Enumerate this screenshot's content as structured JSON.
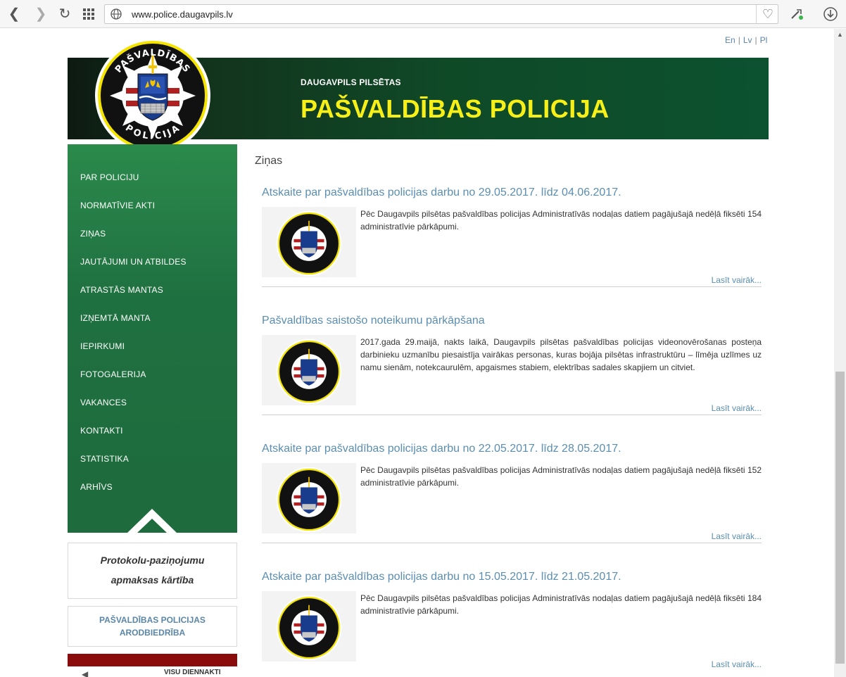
{
  "browser": {
    "url": "www.police.daugavpils.lv"
  },
  "languages": [
    "En",
    "Lv",
    "Pl"
  ],
  "banner": {
    "subtitle": "DAUGAVPILS PILSĒTAS",
    "title": "PAŠVALDĪBAS POLICIJA",
    "logo_text_top": "PAŠVALDĪBAS",
    "logo_text_bottom": "POLICIJA"
  },
  "menu": [
    "PAR POLICIJU",
    "NORMATĪVIE AKTI",
    "ZIŅAS",
    "JAUTĀJUMI UN ATBILDES",
    "ATRASTĀS MANTAS",
    "IZŅEMTĀ MANTA",
    "IEPIRKUMI",
    "FOTOGALERIJA",
    "VAKANCES",
    "KONTAKTI",
    "STATISTIKA",
    "ARHĪVS"
  ],
  "sidebar": {
    "box1_line1": "Protokolu-paziņojumu",
    "box1_line2": "apmaksas kārtība",
    "box2_line1": "PAŠVALDĪBAS POLICIJAS",
    "box2_line2": "ARODBIEDRĪBA",
    "box4_text": "VISU DIENNAKTI"
  },
  "section_title": "Ziņas",
  "news": [
    {
      "title": "Atskaite par pašvaldības policijas darbu no 29.05.2017. līdz 04.06.2017.",
      "text": "Pēc Daugavpils pilsētas pašvaldības policijas Administratīvās nodaļas datiem pagājušajā nedēļā fiksēti 154 administratīvie pārkāpumi.",
      "more": "Lasīt vairāk..."
    },
    {
      "title": "Pašvaldības saistošo noteikumu pārkāpšana",
      "text": "2017.gada 29.maijā, nakts laikā, Daugavpils pilsētas pašvaldības policijas videonovērošanas posteņa darbinieku uzmanību piesaistīja vairākas personas, kuras bojāja pilsētas infrastruktūru – līmēja uzlīmes uz namu sienām, notekcaurulēm, apgaismes stabiem, elektrības sadales skapjiem un citviet.",
      "more": "Lasīt vairāk..."
    },
    {
      "title": "Atskaite par pašvaldības policijas darbu no 22.05.2017. līdz 28.05.2017.",
      "text": "Pēc Daugavpils pilsētas pašvaldības policijas Administratīvās nodaļas datiem pagājušajā nedēļā fiksēti 152 administratīvie pārkāpumi.",
      "more": "Lasīt vairāk..."
    },
    {
      "title": "Atskaite par pašvaldības policijas darbu no 15.05.2017. līdz 21.05.2017.",
      "text": "Pēc Daugavpils pilsētas pašvaldības policijas Administratīvās nodaļas datiem pagājušajā nedēļā fiksēti 184 administratīvie pārkāpumi.",
      "more": "Lasīt vairāk..."
    }
  ]
}
